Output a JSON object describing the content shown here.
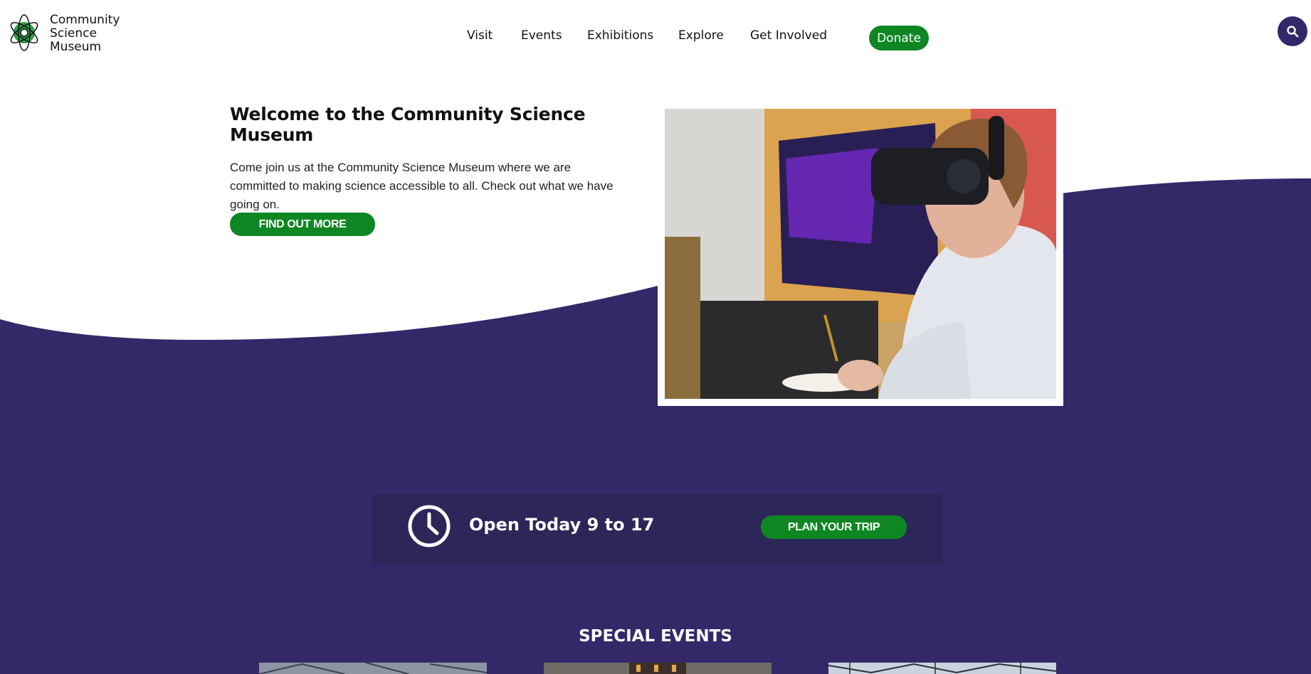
{
  "brand": {
    "name_lines": [
      "Community",
      "Science",
      "Museum"
    ],
    "colors": {
      "primary": "#342869",
      "accent": "#0e8723",
      "panel": "#2d2658"
    }
  },
  "nav": {
    "items": [
      {
        "label": "Visit"
      },
      {
        "label": "Events"
      },
      {
        "label": "Exhibitions"
      },
      {
        "label": "Explore"
      },
      {
        "label": "Get Involved"
      }
    ],
    "donate_label": "Donate",
    "search_icon": "search-icon"
  },
  "hero": {
    "title": "Welcome to the Community Science Museum",
    "body": "Come join us at the Community Science Museum where we are committed to making science accessible to all. Check out what we have going on.",
    "cta_label": "FIND OUT MORE",
    "image_subject": "person-wearing-vr-headset-painting"
  },
  "hours": {
    "icon": "clock-icon",
    "text": "Open Today 9 to 17",
    "cta_label": "PLAN YOUR TRIP"
  },
  "events": {
    "heading": "SPECIAL EVENTS",
    "cards": [
      {
        "image_subject": "building-ceiling"
      },
      {
        "image_subject": "hall-interior"
      },
      {
        "image_subject": "steel-structure"
      }
    ]
  }
}
